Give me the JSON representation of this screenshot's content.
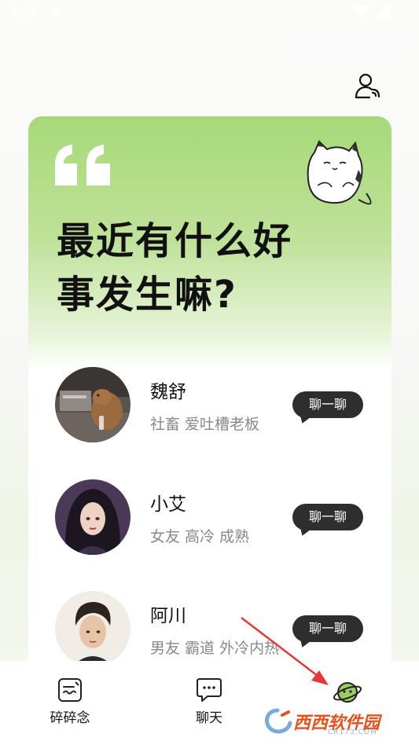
{
  "status_bar": {
    "time": "4:26"
  },
  "card": {
    "headline_line1": "最近有什么好",
    "headline_line2": "事发生嘛?"
  },
  "contacts": [
    {
      "name": "魏舒",
      "tags": "社畜 爱吐槽老板",
      "button": "聊一聊"
    },
    {
      "name": "小艾",
      "tags": "女友 高冷 成熟",
      "button": "聊一聊"
    },
    {
      "name": "阿川",
      "tags": "男友 霸道 外冷内热",
      "button": "聊一聊"
    }
  ],
  "tabs": [
    {
      "label": "碎碎念",
      "icon": "note-icon"
    },
    {
      "label": "聊天",
      "icon": "chat-bubble-icon"
    },
    {
      "label": "",
      "icon": "planet-icon"
    }
  ],
  "watermark": {
    "text": "西西软件园",
    "sub": "CR173.COM"
  },
  "colors": {
    "accent_green": "#a7d978",
    "button_dark": "#2e2e2e",
    "arrow_red": "#e53935"
  }
}
